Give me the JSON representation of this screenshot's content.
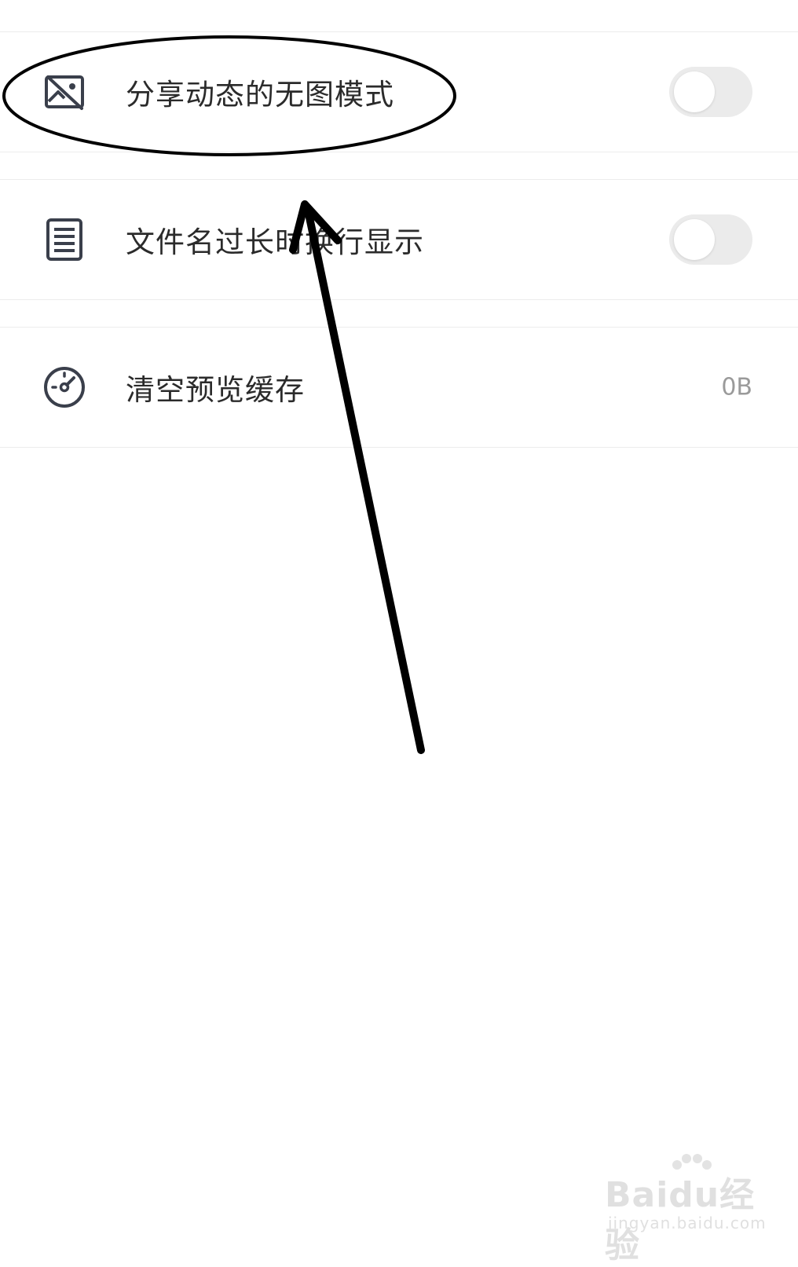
{
  "settings": {
    "items": [
      {
        "label": "分享动态的无图模式",
        "icon": "image-off-icon",
        "control": "toggle",
        "toggle_on": false
      },
      {
        "label": "文件名过长时换行显示",
        "icon": "document-lines-icon",
        "control": "toggle",
        "toggle_on": false
      },
      {
        "label": "清空预览缓存",
        "icon": "speedometer-icon",
        "control": "value",
        "value": "0B"
      }
    ]
  },
  "annotation": {
    "shape": "ellipse-and-arrow",
    "color": "#000000",
    "highlights_item": "分享动态的无图模式"
  },
  "watermark": {
    "brand": "Baidu经验",
    "url": "jingyan.baidu.com"
  },
  "colors": {
    "background": "#ffffff",
    "text": "#2b2b2b",
    "icon": "#3a3f4b",
    "toggle_off": "#ebebeb",
    "value_text": "#9a9a9a"
  }
}
